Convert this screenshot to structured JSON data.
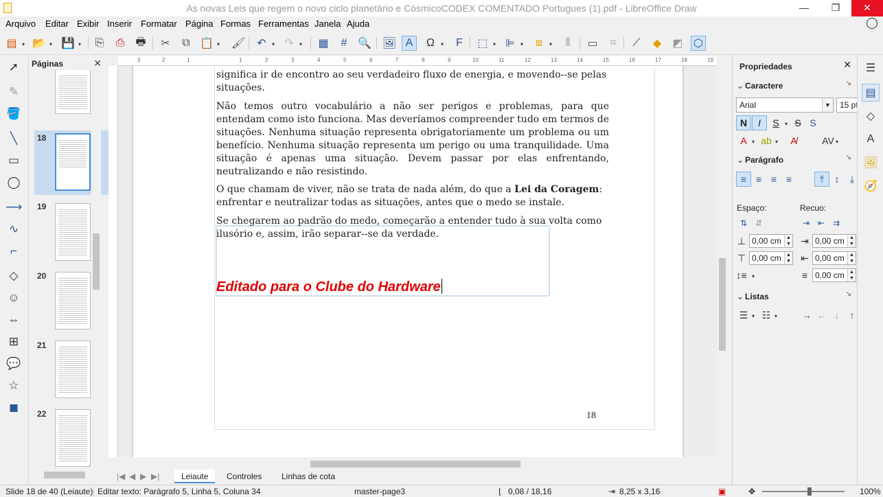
{
  "window": {
    "title": "As novas Leis que regem o novo ciclo planetário e CósmicoCODEX COMENTADO Portugues (1).pdf - LibreOffice Draw",
    "minimize": "—",
    "restore": "❐",
    "close": "✕"
  },
  "menu": [
    "Arquivo",
    "Editar",
    "Exibir",
    "Inserir",
    "Formatar",
    "Página",
    "Formas",
    "Ferramentas",
    "Janela",
    "Ajuda"
  ],
  "slide_pane": {
    "title": "Páginas",
    "close": "✕",
    "thumbnails": [
      "18",
      "19",
      "20",
      "21",
      "22"
    ],
    "active": "18"
  },
  "ruler": {
    "h_ticks": [
      "3",
      "2",
      "1",
      "1",
      "2",
      "3",
      "4",
      "5",
      "6",
      "7",
      "8",
      "9",
      "10",
      "11",
      "12",
      "13",
      "14",
      "15",
      "16",
      "17",
      "18",
      "19"
    ]
  },
  "document": {
    "paragraphs": [
      "significa ir de encontro ao seu verdadeiro fluxo de energia, e movendo--se pelas situações.",
      "Não temos outro vocabulário a não ser perigos e problemas, para que entendam como isto funciona. Mas deveríamos compreender tudo em termos de situações. Nenhuma situação representa obrigatoriamente um problema ou um benefício. Nenhuma situação representa um perigo ou uma tranquilidade. Uma situação é apenas uma situação. Devem passar por elas enfrentando, neutralizando e não resistindo.",
      "O que chamam de viver, não se trata de nada além, do que a",
      "Lei da Coragem",
      ": enfrentar e neutralizar todas as situações, antes que o medo se instale.",
      "Se chegarem ao padrão do medo, começarão a entender tudo à sua volta como ilusório e, assim, irão separar--se da verdade."
    ],
    "edited_text": "Editado para o Clube do  Hardware",
    "page_number": "18"
  },
  "tabs": [
    "Leiaute",
    "Controles",
    "Linhas de cota"
  ],
  "active_tab": "Leiaute",
  "sidebar": {
    "title": "Propriedades",
    "character": {
      "label": "Caractere",
      "font": "Arial",
      "size": "15 pt",
      "bold": "N",
      "italic": "I",
      "underline": "S",
      "strike": "S",
      "shadow": "S"
    },
    "paragraph": {
      "label": "Parágrafo",
      "spacing_label": "Espaço:",
      "indent_label": "Recuo:",
      "above": "0,00 cm",
      "below": "0,00 cm",
      "before": "0,00 cm",
      "after": "0,00 cm",
      "first": "0,00 cm"
    },
    "lists": {
      "label": "Listas"
    }
  },
  "status": {
    "slide": "Slide 18 de 40 (Leiaute)",
    "edit": "Editar texto: Parágrafo 5, Linha 5, Coluna 34",
    "master": "master-page3",
    "position": "0,08 / 18,16",
    "size": "8,25 x 3,16",
    "zoom": "100%"
  },
  "colors": {
    "accent": "#4a90d9",
    "edited_text": "#e00000",
    "close_button": "#e81123"
  }
}
